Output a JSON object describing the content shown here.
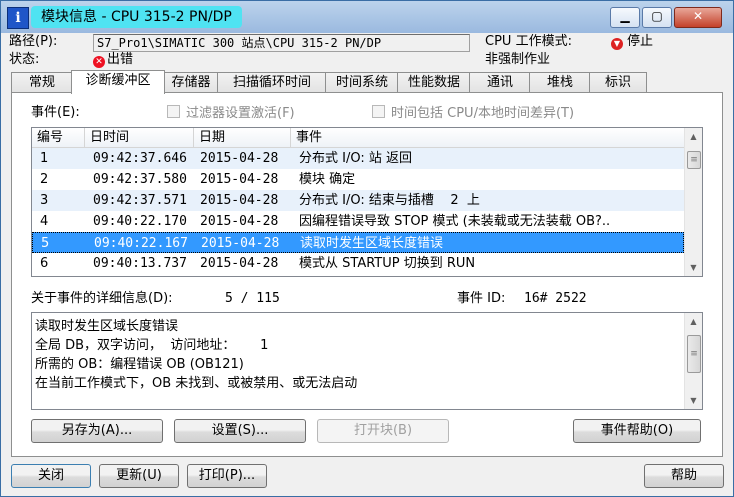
{
  "window": {
    "title": "模块信息 - CPU 315-2 PN/DP",
    "controls": {
      "minimize": "▁",
      "maximize": "▢",
      "close": "✕"
    }
  },
  "header": {
    "path_label": "路径(P):",
    "path_value": "S7_Pro1\\SIMATIC 300 站点\\CPU 315-2 PN/DP",
    "status_label": "状态:",
    "status_value": "出错",
    "mode_label": "CPU 工作模式:",
    "mode_value": "停止",
    "force_value": "非强制作业"
  },
  "tabs": [
    {
      "label": "常规"
    },
    {
      "label": "诊断缓冲区",
      "active": true
    },
    {
      "label": "存储器"
    },
    {
      "label": "扫描循环时间"
    },
    {
      "label": "时间系统"
    },
    {
      "label": "性能数据"
    },
    {
      "label": "通讯"
    },
    {
      "label": "堆栈"
    },
    {
      "label": "标识"
    }
  ],
  "events": {
    "label": "事件(E):",
    "filter_checkbox": "过滤器设置激活(F)",
    "time_checkbox": "时间包括 CPU/本地时间差异(T)",
    "columns": [
      "编号",
      "日时间",
      "日期",
      "事件"
    ],
    "rows": [
      {
        "no": "1",
        "time": "09:42:37.646",
        "date": "2015-04-28",
        "event": "分布式 I/O: 站 返回"
      },
      {
        "no": "2",
        "time": "09:42:37.580",
        "date": "2015-04-28",
        "event": "模块 确定"
      },
      {
        "no": "3",
        "time": "09:42:37.571",
        "date": "2015-04-28",
        "event": "分布式 I/O: 结束与插槽    2  上"
      },
      {
        "no": "4",
        "time": "09:40:22.170",
        "date": "2015-04-28",
        "event": "因编程错误导致 STOP 模式 (未装载或无法装载 OB?.."
      },
      {
        "no": "5",
        "time": "09:40:22.167",
        "date": "2015-04-28",
        "event": "读取时发生区域长度错误"
      },
      {
        "no": "6",
        "time": "09:40:13.737",
        "date": "2015-04-28",
        "event": "模式从 STARTUP 切换到 RUN"
      }
    ]
  },
  "details": {
    "label": "关于事件的详细信息(D):",
    "position": "5 / 115",
    "event_id_label": "事件 ID:",
    "event_id_value": "16# 2522",
    "lines": [
      "读取时发生区域长度错误",
      "全局 DB，双字访问，  访问地址：      1",
      "所需的 OB：编程错误 OB (OB121)",
      "在当前工作模式下，OB 未找到、或被禁用、或无法启动"
    ]
  },
  "buttons": {
    "save_as": "另存为(A)...",
    "settings": "设置(S)...",
    "open_block": "打开块(B)",
    "event_help": "事件帮助(O)",
    "close": "关闭",
    "update": "更新(U)",
    "print": "打印(P)...",
    "help": "帮助"
  }
}
